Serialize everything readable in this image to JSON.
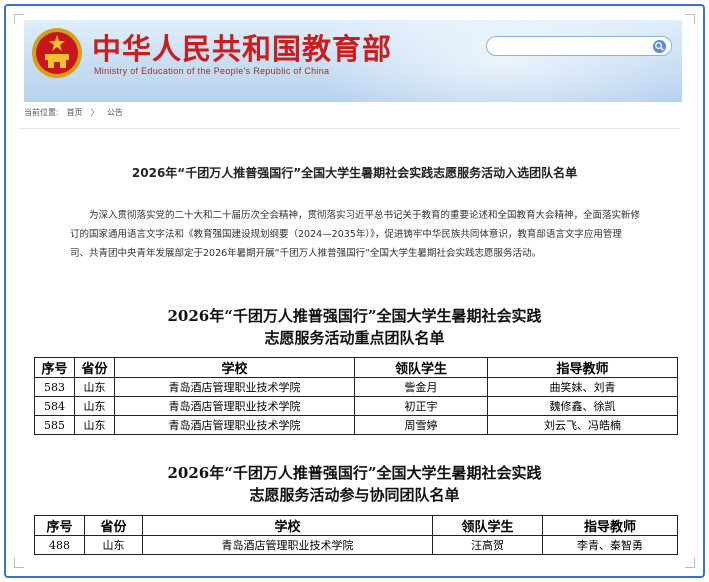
{
  "site": {
    "title_cn": "中华人民共和国教育部",
    "title_en": "Ministry of Education of the People's Republic of China",
    "search_placeholder": ""
  },
  "breadcrumb": {
    "prefix": "当前位置:",
    "home": "首页",
    "sep": "〉",
    "current": "公告"
  },
  "notice": {
    "title": "2026年“千团万人推普强国行”全国大学生暑期社会实践志愿服务活动入选团队名单",
    "body": "为深入贯彻落实党的二十大和二十届历次全会精神，贯彻落实习近平总书记关于教育的重要论述和全国教育大会精神，全面落实新修订的国家通用语言文字法和《教育强国建设规划纲要（2024—2035年）》，促进铸牢中华民族共同体意识，教育部语言文字应用管理司、共青团中央青年发展部定于2026年暑期开展“千团万人推普强国行”全国大学生暑期社会实践志愿服务活动。"
  },
  "section1": {
    "title_line1": "2026年“千团万人推普强国行”全国大学生暑期社会实践",
    "title_line2": "志愿服务活动重点团队名单",
    "headers": [
      "序号",
      "省份",
      "学校",
      "领队学生",
      "指导教师"
    ],
    "rows": [
      [
        "583",
        "山东",
        "青岛酒店管理职业技术学院",
        "訾金月",
        "曲笑妹、刘青"
      ],
      [
        "584",
        "山东",
        "青岛酒店管理职业技术学院",
        "初正宇",
        "魏修鑫、徐凯"
      ],
      [
        "585",
        "山东",
        "青岛酒店管理职业技术学院",
        "周雪婷",
        "刘云飞、冯皓楠"
      ]
    ]
  },
  "section2": {
    "title_line1": "2026年“千团万人推普强国行”全国大学生暑期社会实践",
    "title_line2": "志愿服务活动参与协同团队名单",
    "headers": [
      "序号",
      "省份",
      "学校",
      "领队学生",
      "指导教师"
    ],
    "rows": [
      [
        "488",
        "山东",
        "青岛酒店管理职业技术学院",
        "汪高贺",
        "李青、秦智勇"
      ]
    ]
  },
  "colors": {
    "header_red": "#c81e1e",
    "frame_blue": "#3b6fd3"
  },
  "icons": {
    "emblem": "national-emblem-icon",
    "search": "search-icon"
  }
}
